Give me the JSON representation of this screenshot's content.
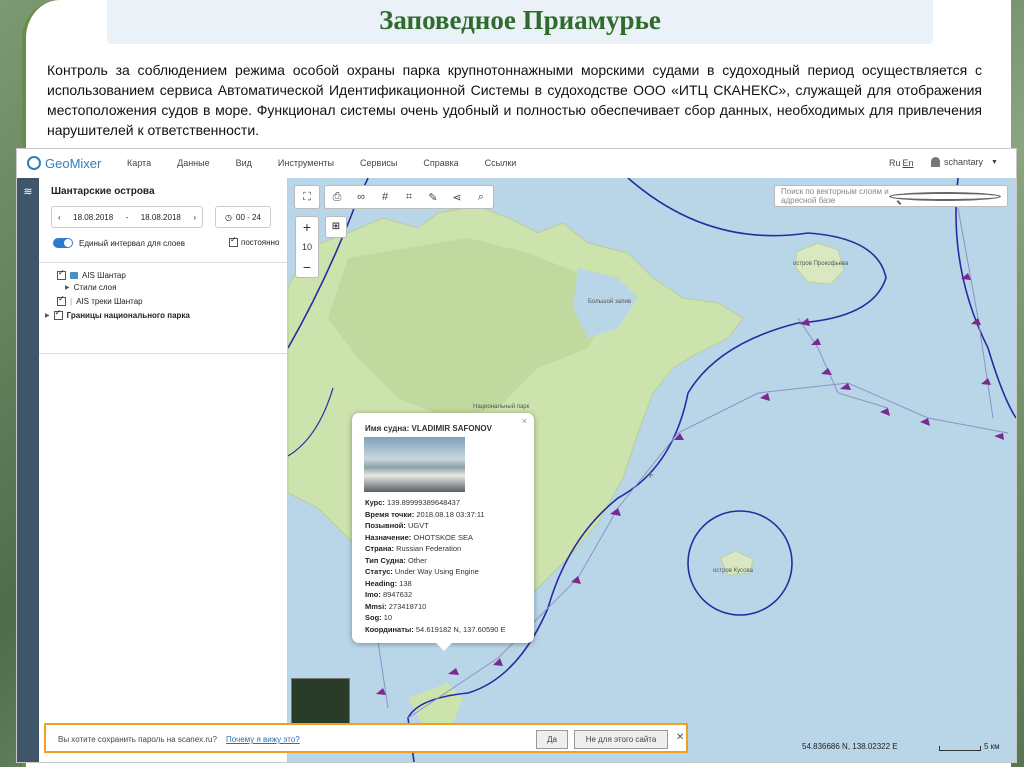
{
  "slide": {
    "title": "Заповедное Приамурье",
    "paragraph": "Контроль за соблюдением режима особой охраны парка  крупнотоннажными морскими судами в судоходный период осуществляется с использованием сервиса Автоматической Идентификационной Системы в судоходстве ООО «ИТЦ СКАНЕКС», служащей для отображения местоположения судов в море. Функционал системы очень удобный и полностью обеспечивает сбор данных, необходимых для привлечения нарушителей к ответственности."
  },
  "app": {
    "logo": "GeoMixer",
    "menu": [
      "Карта",
      "Данные",
      "Вид",
      "Инструменты",
      "Сервисы",
      "Справка",
      "Ссылки"
    ],
    "lang_ru": "Ru",
    "lang_en": "En",
    "user": "schantary"
  },
  "panel": {
    "title": "Шантарские острова",
    "date_from": "18.08.2018",
    "date_sep": "-",
    "date_to": "18.08.2018",
    "time_range": "00 - 24",
    "single_interval": "Единый интервал для слоев",
    "permanent": "постоянно",
    "layers": [
      {
        "label": "AIS Шантар",
        "checked": true
      },
      {
        "label": "Стили слоя"
      },
      {
        "label": "AIS треки Шантар",
        "checked": true
      },
      {
        "label": "Границы национального парка",
        "checked": true
      }
    ]
  },
  "map": {
    "search_placeholder": "Поиск по векторным слоям и адресной базе",
    "zoom_level": "10",
    "labels": {
      "prokofiev": "остров Прокофьева",
      "kusova": "остров Кусова",
      "bay": "Большой залив",
      "settlement": "Национальный парк"
    },
    "coords": "54.836686 N, 138.02322 E",
    "scale": "5 км"
  },
  "popup": {
    "vessel_label": "Имя судна:",
    "vessel_name": "VLADIMIR SAFONOV",
    "rows": [
      {
        "k": "Курс:",
        "v": "139.89999389648437"
      },
      {
        "k": "Время точки:",
        "v": "2018.08.18 03:37:11"
      },
      {
        "k": "Позывной:",
        "v": "UGVT"
      },
      {
        "k": "Назначение:",
        "v": "OHOTSKOE SEA"
      },
      {
        "k": "Страна:",
        "v": "Russian Federation"
      },
      {
        "k": "Тип Судна:",
        "v": "Other"
      },
      {
        "k": "Статус:",
        "v": "Under Way Using Engine"
      },
      {
        "k": "Heading:",
        "v": "138"
      },
      {
        "k": "Imo:",
        "v": "8947632"
      },
      {
        "k": "Mmsi:",
        "v": "273418710"
      },
      {
        "k": "Sog:",
        "v": "10"
      },
      {
        "k": "Координаты:",
        "v": "54.619182 N, 137.60590 E"
      }
    ]
  },
  "savebar": {
    "question": "Вы хотите сохранить пароль на scanex.ru?",
    "why": "Почему я вижу это?",
    "yes": "Да",
    "no": "Не для этого сайта"
  }
}
